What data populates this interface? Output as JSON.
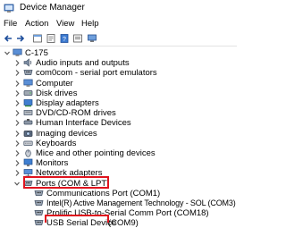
{
  "window": {
    "title": "Device Manager"
  },
  "menu": [
    {
      "id": "file",
      "label": "File"
    },
    {
      "id": "action",
      "label": "Action"
    },
    {
      "id": "view",
      "label": "View"
    },
    {
      "id": "help",
      "label": "Help"
    }
  ],
  "toolbar": [
    {
      "name": "back-arrow-icon"
    },
    {
      "name": "forward-arrow-icon"
    },
    {
      "name": "window-pane-icon"
    },
    {
      "name": "properties-icon"
    },
    {
      "name": "help-book-icon"
    },
    {
      "name": "window-list-icon"
    },
    {
      "name": "computer-monitor-icon"
    }
  ],
  "tree": {
    "root": {
      "label": "C-175",
      "expanded": true
    },
    "categories": [
      {
        "label": "Audio inputs and outputs",
        "icon": "speaker-icon",
        "expanded": false
      },
      {
        "label": "com0com - serial port emulators",
        "icon": "port-icon",
        "expanded": false
      },
      {
        "label": "Computer",
        "icon": "computer-icon",
        "expanded": false
      },
      {
        "label": "Disk drives",
        "icon": "disk-drive-icon",
        "expanded": false
      },
      {
        "label": "Display adapters",
        "icon": "display-adapter-icon",
        "expanded": false
      },
      {
        "label": "DVD/CD-ROM drives",
        "icon": "dvd-drive-icon",
        "expanded": false
      },
      {
        "label": "Human Interface Devices",
        "icon": "hid-icon",
        "expanded": false
      },
      {
        "label": "Imaging devices",
        "icon": "camera-icon",
        "expanded": false
      },
      {
        "label": "Keyboards",
        "icon": "keyboard-icon",
        "expanded": false
      },
      {
        "label": "Mice and other pointing devices",
        "icon": "mouse-icon",
        "expanded": false
      },
      {
        "label": "Monitors",
        "icon": "monitor-icon",
        "expanded": false
      },
      {
        "label": "Network adapters",
        "icon": "network-adapter-icon",
        "expanded": false
      },
      {
        "label": "Ports (COM & LPT)",
        "icon": "port-icon",
        "expanded": true
      }
    ],
    "ports_children": [
      {
        "label": "Communications Port (COM1)",
        "icon": "port-icon"
      },
      {
        "label": "Intel(R) Active Management Technology - SOL (COM3)",
        "icon": "port-icon"
      },
      {
        "label": "Prolific USB-to-Serial Comm Port (COM18)",
        "icon": "port-icon"
      },
      {
        "label": "USB Serial Device",
        "icon": "port-icon",
        "suffix": "(COM9)"
      }
    ]
  },
  "colors": {
    "highlight_border": "#e0141e",
    "caret": "#555555",
    "icon_blue": "#2a6fc7"
  }
}
